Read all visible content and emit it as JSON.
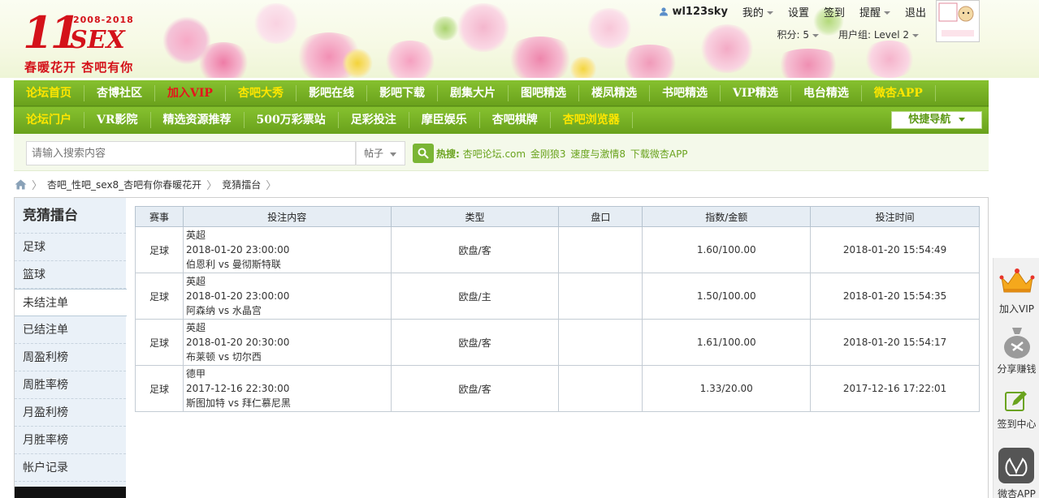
{
  "logo": {
    "number": "11",
    "sex_text": "SEX",
    "years": "2008-2018",
    "slogan": "春暖花开  杏吧有你"
  },
  "userbar": {
    "username": "wl123sky",
    "my": "我的",
    "settings": "设置",
    "checkin": "签到",
    "remind": "提醒",
    "logout": "退出",
    "points": "积分: 5",
    "group": "用户组: Level 2"
  },
  "nav": {
    "row1": [
      {
        "label": "论坛首页",
        "color": "yellow"
      },
      {
        "label": "杏博社区",
        "color": "white"
      },
      {
        "label": "加入VIP",
        "color": "red"
      },
      {
        "label": "杏吧大秀",
        "color": "yellow"
      },
      {
        "label": "影吧在线",
        "color": "white"
      },
      {
        "label": "影吧下载",
        "color": "white"
      },
      {
        "label": "剧集大片",
        "color": "white"
      },
      {
        "label": "图吧精选",
        "color": "white"
      },
      {
        "label": "楼凤精选",
        "color": "white"
      },
      {
        "label": "书吧精选",
        "color": "white"
      },
      {
        "label": "VIP精选",
        "color": "white"
      },
      {
        "label": "电台精选",
        "color": "white"
      },
      {
        "label": "微杏APP",
        "color": "yellow"
      }
    ],
    "row2": [
      {
        "label": "论坛门户",
        "color": "yellow"
      },
      {
        "label": "VR影院",
        "color": "white"
      },
      {
        "label": "精选资源推荐",
        "color": "white"
      },
      {
        "label": "500万彩票站",
        "color": "white"
      },
      {
        "label": "足彩投注",
        "color": "white"
      },
      {
        "label": "摩臣娱乐",
        "color": "white"
      },
      {
        "label": "杏吧棋牌",
        "color": "white"
      },
      {
        "label": "杏吧浏览器",
        "color": "yellow"
      }
    ],
    "quicknav": "快捷导航"
  },
  "search": {
    "placeholder": "请输入搜索内容",
    "type": "帖子",
    "hot_label": "热搜:",
    "hot_links": [
      "杏吧论坛.com",
      "金刚狼3",
      "速度与激情8",
      "下载微杏APP"
    ]
  },
  "breadcrumb": {
    "home_icon": "home-icon",
    "items": [
      "杏吧_性吧_sex8_杏吧有你春暖花开",
      "竞猜擂台"
    ]
  },
  "sidebar": {
    "title": "竞猜擂台",
    "items": [
      "足球",
      "篮球",
      "未结注单",
      "已结注单",
      "周盈利榜",
      "周胜率榜",
      "月盈利榜",
      "月胜率榜",
      "帐户记录"
    ],
    "active_index": 2
  },
  "table": {
    "headers": [
      "赛事",
      "投注内容",
      "类型",
      "盘口",
      "指数/金额",
      "投注时间"
    ],
    "rows": [
      {
        "event": "足球",
        "league": "英超",
        "match_time": "2018-01-20 23:00:00",
        "teams": "伯恩利 vs 曼彻斯特联",
        "type": "欧盘/客",
        "handicap": "",
        "odds": "1.60/100.00",
        "bet_time": "2018-01-20 15:54:49"
      },
      {
        "event": "足球",
        "league": "英超",
        "match_time": "2018-01-20 23:00:00",
        "teams": "阿森纳 vs 水晶宫",
        "type": "欧盘/主",
        "handicap": "",
        "odds": "1.50/100.00",
        "bet_time": "2018-01-20 15:54:35"
      },
      {
        "event": "足球",
        "league": "英超",
        "match_time": "2018-01-20 20:30:00",
        "teams": "布莱顿 vs 切尔西",
        "type": "欧盘/客",
        "handicap": "",
        "odds": "1.61/100.00",
        "bet_time": "2018-01-20 15:54:17"
      },
      {
        "event": "足球",
        "league": "德甲",
        "match_time": "2017-12-16 22:30:00",
        "teams": "斯图加特 vs 拜仁慕尼黑",
        "type": "欧盘/客",
        "handicap": "",
        "odds": "1.33/20.00",
        "bet_time": "2017-12-16 17:22:01"
      }
    ]
  },
  "rightfloat": {
    "vip": "加入VIP",
    "share": "分享赚钱",
    "checkin": "签到中心",
    "app": "微杏APP"
  },
  "colors": {
    "nav_green": "#6aa31e",
    "nav_yellow": "#ffe600",
    "nav_red": "#e5141c",
    "brand_red": "#d4121a"
  }
}
